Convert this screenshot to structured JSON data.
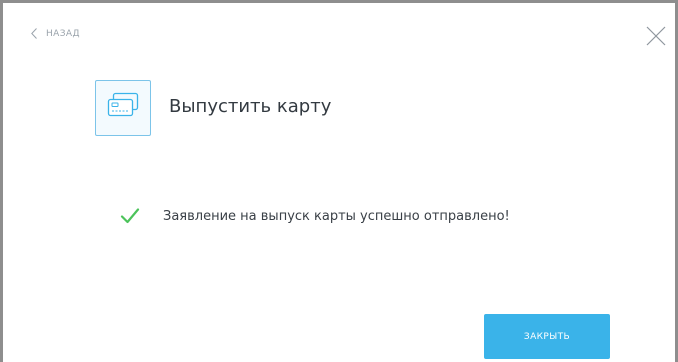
{
  "header": {
    "back_label": "НАЗАД"
  },
  "main": {
    "title": "Выпустить карту",
    "success_message": "Заявление на выпуск карты успешно отправлено!"
  },
  "footer": {
    "close_label": "ЗАКРЫТЬ"
  },
  "icons": {
    "back": "chevron-left-icon",
    "close": "close-icon",
    "card": "card-icon",
    "success": "check-icon"
  },
  "colors": {
    "accent": "#3ab3e9",
    "success": "#4cc35b",
    "tile_border": "#7cc4e9",
    "title_text": "#333a41",
    "muted_text": "#9aa3ab"
  }
}
